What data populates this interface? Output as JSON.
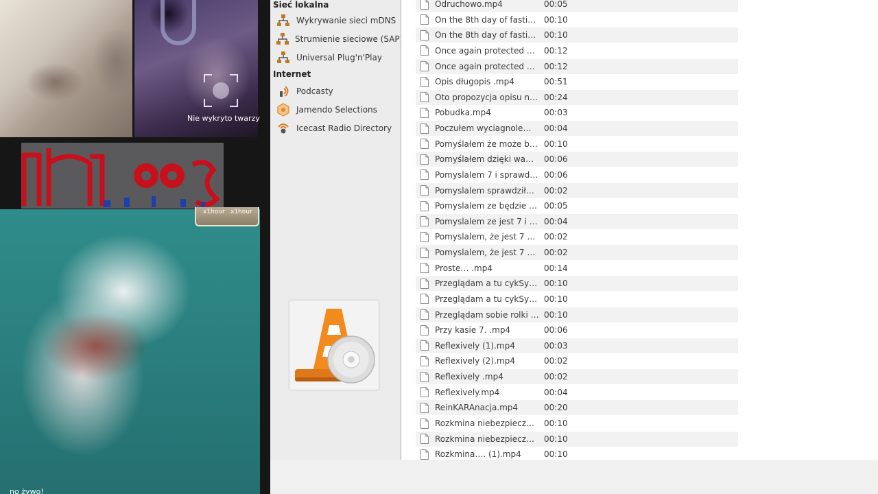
{
  "collage": {
    "face_status": "Nie wykryto twarzy",
    "badges": [
      "x1hour",
      "x1hour"
    ],
    "bottom_caption": "no żywo!"
  },
  "sidebar": {
    "sections": [
      {
        "header": "Sieć lokalna",
        "items": [
          {
            "label": "Wykrywanie sieci mDNS",
            "icon": "network-icon"
          },
          {
            "label": "Strumienie sieciowe (SAP)",
            "icon": "network-icon"
          },
          {
            "label": "Universal Plug'n'Play",
            "icon": "network-icon"
          }
        ]
      },
      {
        "header": "Internet",
        "items": [
          {
            "label": "Podcasty",
            "icon": "podcast-icon"
          },
          {
            "label": "Jamendo Selections",
            "icon": "jamendo-icon"
          },
          {
            "label": "Icecast Radio Directory",
            "icon": "radio-icon"
          }
        ]
      }
    ]
  },
  "playlist": {
    "rows": [
      {
        "title": "Odruchowo.mp4",
        "duration": "00:05"
      },
      {
        "title": "On the 8th day of fasting, y...",
        "duration": "00:10"
      },
      {
        "title": "On the 8th day of fasting, y...",
        "duration": "00:10"
      },
      {
        "title": "Once again protected by the...",
        "duration": "00:12"
      },
      {
        "title": "Once again protected by the...",
        "duration": "00:12"
      },
      {
        "title": "Opis długopis .mp4",
        "duration": "00:51"
      },
      {
        "title": "Oto propozycja opisu na Tik...",
        "duration": "00:24"
      },
      {
        "title": "Pobudka.mp4",
        "duration": "00:03"
      },
      {
        "title": "Poczułem wyciagnolem spra...",
        "duration": "00:04"
      },
      {
        "title": "Pomyślałem że może być sie...",
        "duration": "00:10"
      },
      {
        "title": "Pomyślałem dzięki wam Ojcz...",
        "duration": "00:06"
      },
      {
        "title": "Pomyslalem 7 i sprawdzilem i ...",
        "duration": "00:06"
      },
      {
        "title": "Pomyslalem sprawdziłem i 7....",
        "duration": "00:02"
      },
      {
        "title": "Pomyslalem ze będzie 7 wyci...",
        "duration": "00:05"
      },
      {
        "title": "Pomyslalem ze jest 7 i jest 7 ...",
        "duration": "00:04"
      },
      {
        "title": "Pomyslalem, że jest 7 noi 7. ...",
        "duration": "00:02"
      },
      {
        "title": "Pomyslalem, że jest 7 noi 7. ...",
        "duration": "00:02"
      },
      {
        "title": "Proste… .mp4",
        "duration": "00:14"
      },
      {
        "title": "Przeglądam a tu cykSync.  (...",
        "duration": "00:10"
      },
      {
        "title": "Przeglądam a tu cykSync. .m...",
        "duration": "00:10"
      },
      {
        "title": "Przeglądam sobie rolki a tu c...",
        "duration": "00:10"
      },
      {
        "title": "Przy kasie 7. .mp4",
        "duration": "00:06"
      },
      {
        "title": "Reflexively  (1).mp4",
        "duration": "00:03"
      },
      {
        "title": "Reflexively  (2).mp4",
        "duration": "00:02"
      },
      {
        "title": "Reflexively .mp4",
        "duration": "00:02"
      },
      {
        "title": "Reflexively.mp4",
        "duration": "00:04"
      },
      {
        "title": "ReinKARAnacja.mp4",
        "duration": "00:20"
      },
      {
        "title": "Rozkmina niebezpieczna min...",
        "duration": "00:10"
      },
      {
        "title": "Rozkmina niebezpieczna min...",
        "duration": "00:10"
      },
      {
        "title": "Rozkmina….  (1).mp4",
        "duration": "00:10"
      }
    ]
  },
  "colors": {
    "sidebar_bg": "#ececec",
    "playlist_bg": "#ffffff",
    "row_alt_bg": "#f2f2f2",
    "vlc_orange": "#f28a1e"
  }
}
